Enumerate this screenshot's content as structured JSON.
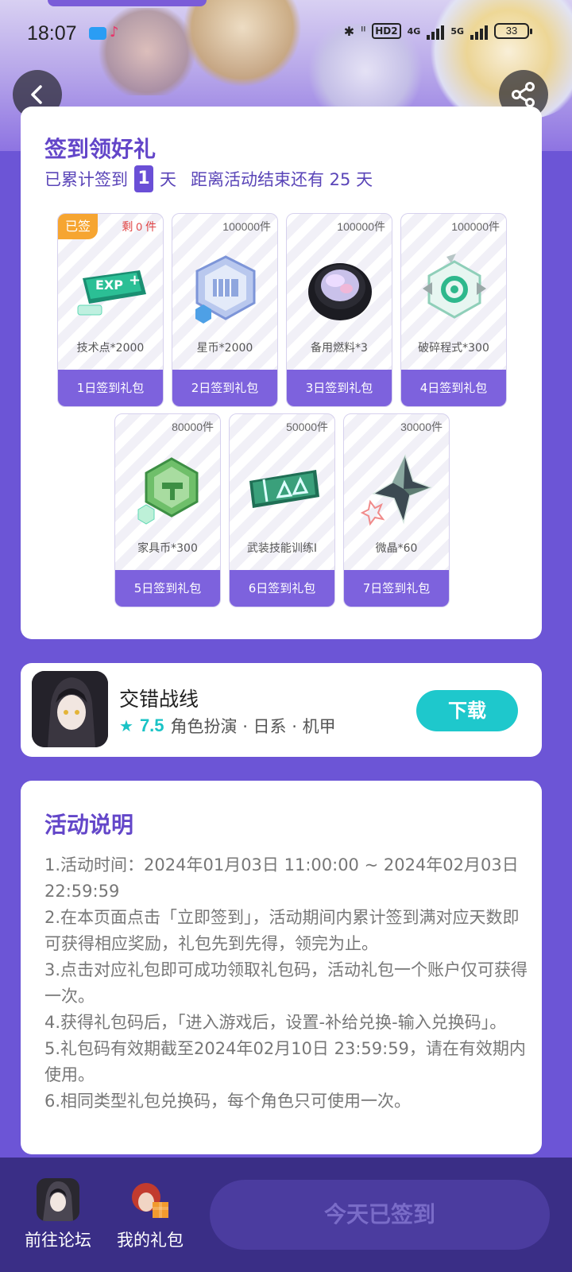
{
  "status_bar": {
    "time": "18:07",
    "network_4g": "4G",
    "network_5g": "5G",
    "hd": "HD2",
    "battery": "33"
  },
  "signin": {
    "title": "签到领好礼",
    "sub_prefix": "已累计签到",
    "days_signed": "1",
    "sub_unit": "天",
    "sub_remaining": "距离活动结束还有 25 天",
    "gifts": [
      {
        "count": "剩 0 件",
        "name": "技术点*2000",
        "label": "1日签到礼包",
        "signed": "已签",
        "icon": "exp-ticket-icon"
      },
      {
        "count": "100000件",
        "name": "星币*2000",
        "label": "2日签到礼包",
        "icon": "star-coin-icon"
      },
      {
        "count": "100000件",
        "name": "备用燃料*3",
        "label": "3日签到礼包",
        "icon": "fuel-icon"
      },
      {
        "count": "100000件",
        "name": "破碎程式*300",
        "label": "4日签到礼包",
        "icon": "program-icon"
      },
      {
        "count": "80000件",
        "name": "家具币*300",
        "label": "5日签到礼包",
        "icon": "furniture-coin-icon"
      },
      {
        "count": "50000件",
        "name": "武装技能训练I",
        "label": "6日签到礼包",
        "icon": "skill-ticket-icon"
      },
      {
        "count": "30000件",
        "name": "微晶*60",
        "label": "7日签到礼包",
        "icon": "crystal-icon"
      }
    ]
  },
  "game": {
    "name": "交错战线",
    "score": "7.5",
    "tags": "角色扮演 · 日系 · 机甲",
    "download": "下载"
  },
  "rules": {
    "title": "活动说明",
    "items": [
      "1.活动时间：2024年01月03日 11:00:00 ~ 2024年02月03日 22:59:59",
      "2.在本页面点击「立即签到」，活动期间内累计签到满对应天数即可获得相应奖励，礼包先到先得，领完为止。",
      "3.点击对应礼包即可成功领取礼包码，活动礼包一个账户仅可获得一次。",
      "4.获得礼包码后，「进入游戏后，设置-补给兑换-输入兑换码」。",
      "5.礼包码有效期截至2024年02月10日 23:59:59，请在有效期内使用。",
      "6.相同类型礼包兑换码，每个角色只可使用一次。"
    ]
  },
  "bottom": {
    "forum": "前往论坛",
    "my_gifts": "我的礼包",
    "signed_button": "今天已签到"
  },
  "colors": {
    "primary": "#6c55d6",
    "accent_teal": "#1ec8cc",
    "signed_badge": "#f6a531"
  }
}
